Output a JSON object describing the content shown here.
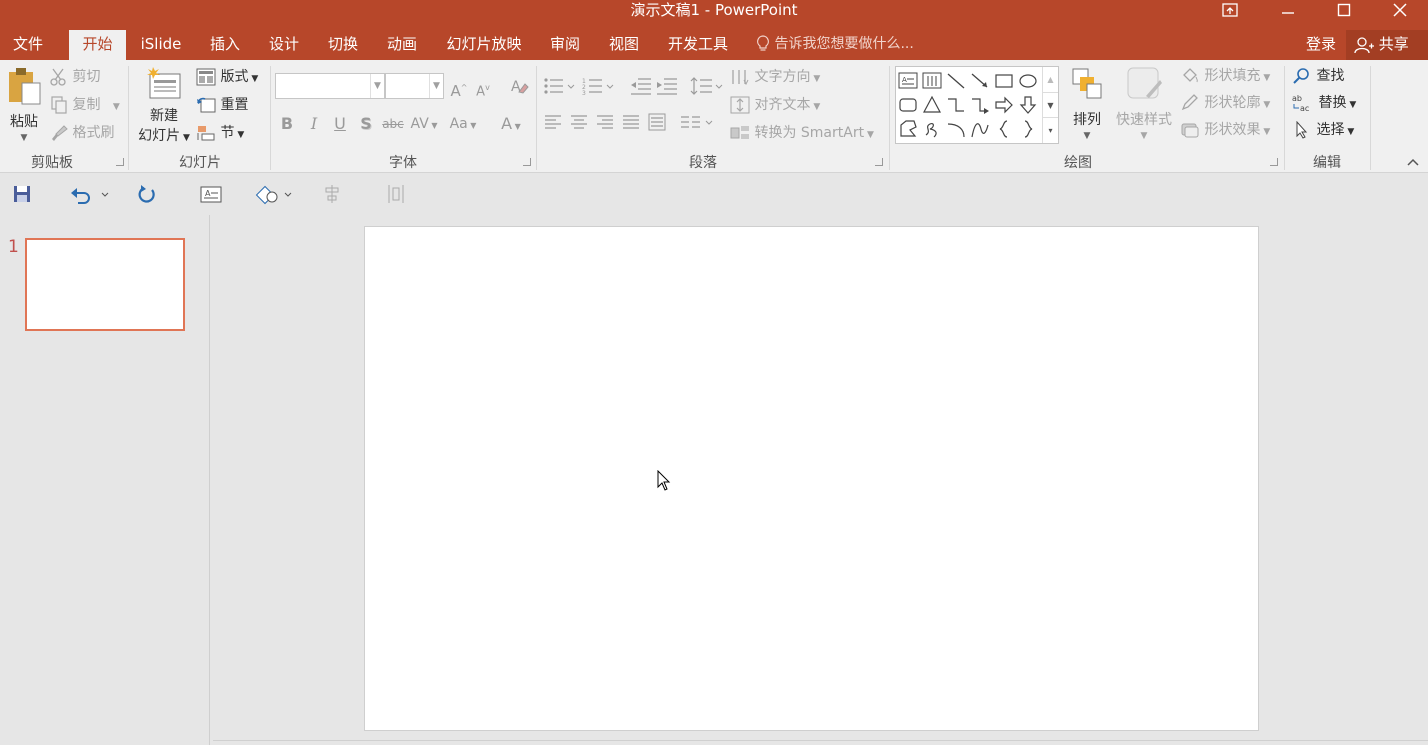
{
  "window": {
    "title": "演示文稿1 - PowerPoint",
    "controls": [
      "ribbon-display-icon",
      "minimize-icon",
      "maximize-icon",
      "close-icon"
    ]
  },
  "tabs": [
    {
      "label": "文件",
      "active": false
    },
    {
      "label": "开始",
      "active": true
    },
    {
      "label": "iSlide",
      "active": false
    },
    {
      "label": "插入",
      "active": false
    },
    {
      "label": "设计",
      "active": false
    },
    {
      "label": "切换",
      "active": false
    },
    {
      "label": "动画",
      "active": false
    },
    {
      "label": "幻灯片放映",
      "active": false
    },
    {
      "label": "审阅",
      "active": false
    },
    {
      "label": "视图",
      "active": false
    },
    {
      "label": "开发工具",
      "active": false
    }
  ],
  "tellme": {
    "text": "告诉我您想要做什么..."
  },
  "account": {
    "login": "登录",
    "share": "共享"
  },
  "ribbon": {
    "clipboard": {
      "label": "剪贴板",
      "paste": "粘贴",
      "cut": "剪切",
      "copy": "复制",
      "format_painter": "格式刷"
    },
    "slides": {
      "label": "幻灯片",
      "new_slide_line1": "新建",
      "new_slide_line2": "幻灯片",
      "layout": "版式",
      "reset": "重置",
      "section": "节"
    },
    "font": {
      "label": "字体",
      "font_name": "",
      "font_size": "",
      "bold": "B",
      "italic": "I",
      "underline": "U",
      "shadow": "S",
      "strike": "abc",
      "spacing": "AV",
      "case": "Aa",
      "color": "A"
    },
    "paragraph": {
      "label": "段落",
      "text_direction": "文字方向",
      "align_text": "对齐文本",
      "smartart": "转换为 SmartArt"
    },
    "drawing": {
      "label": "绘图",
      "arrange": "排列",
      "quick_styles": "快速样式",
      "shape_fill": "形状填充",
      "shape_outline": "形状轮廓",
      "shape_effects": "形状效果"
    },
    "editing": {
      "label": "编辑",
      "find": "查找",
      "replace": "替换",
      "select": "选择"
    }
  },
  "slides_panel": {
    "slide_number": "1"
  },
  "colors": {
    "accent": "#b7472a",
    "thumb_border": "#e07555"
  }
}
